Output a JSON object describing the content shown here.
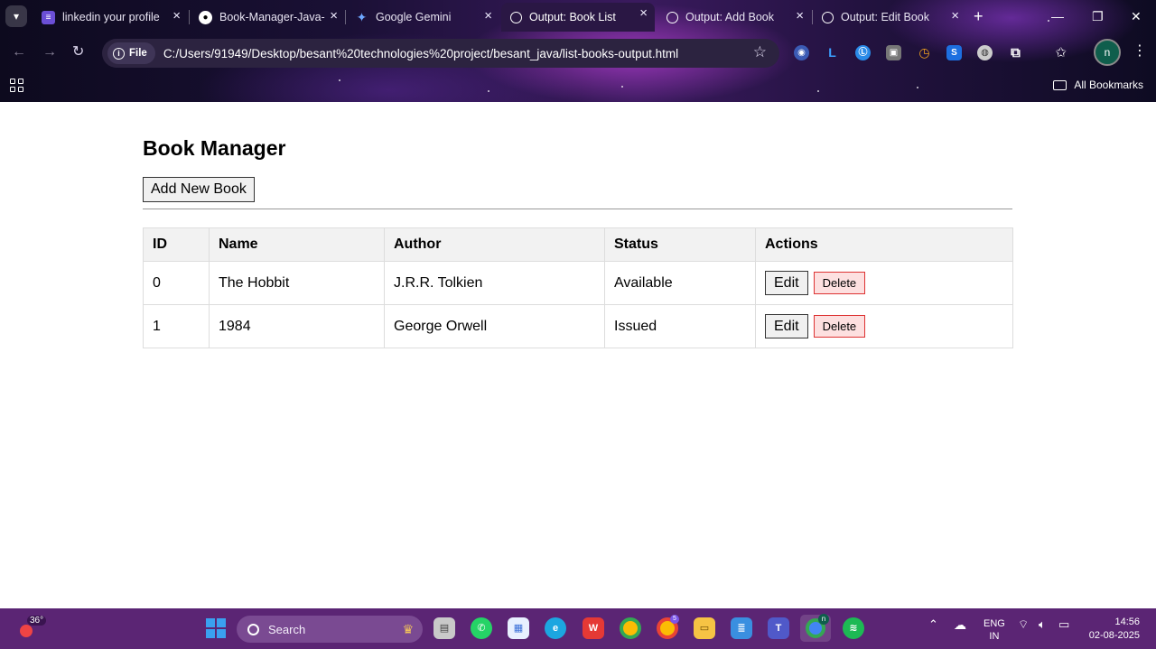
{
  "browser": {
    "tabs": [
      {
        "title": "linkedin your profile",
        "icon": "forms-icon",
        "icon_color": "#6b4fd6",
        "active": false
      },
      {
        "title": "Book-Manager-Java-",
        "icon": "github-icon",
        "icon_color": "#ffffff",
        "active": false
      },
      {
        "title": "Google Gemini",
        "icon": "gemini-icon",
        "icon_color": "#6ea8ff",
        "active": false
      },
      {
        "title": "Output: Book List",
        "icon": "globe-icon",
        "icon_color": "#ffffff",
        "active": true
      },
      {
        "title": "Output: Add Book",
        "icon": "globe-icon",
        "icon_color": "#ffffff",
        "active": false
      },
      {
        "title": "Output: Edit Book",
        "icon": "globe-icon",
        "icon_color": "#ffffff",
        "active": false
      }
    ],
    "address": {
      "scheme_label": "File",
      "url": "C:/Users/91949/Desktop/besant%20technologies%20project/besant_java/list-books-output.html"
    },
    "profile_initial": "n",
    "bookmarks_label": "All Bookmarks"
  },
  "page": {
    "title": "Book Manager",
    "add_button_label": "Add New Book",
    "table": {
      "headers": [
        "ID",
        "Name",
        "Author",
        "Status",
        "Actions"
      ],
      "rows": [
        {
          "id": "0",
          "name": "The Hobbit",
          "author": "J.R.R. Tolkien",
          "status": "Available"
        },
        {
          "id": "1",
          "name": "1984",
          "author": "George Orwell",
          "status": "Issued"
        }
      ],
      "edit_label": "Edit",
      "delete_label": "Delete"
    }
  },
  "taskbar": {
    "weather_temp": "36°",
    "search_placeholder": "Search",
    "language": "ENG",
    "region": "IN",
    "time": "14:56",
    "date": "02-08-2025",
    "profile_badge": "n",
    "notification_count": "5"
  }
}
